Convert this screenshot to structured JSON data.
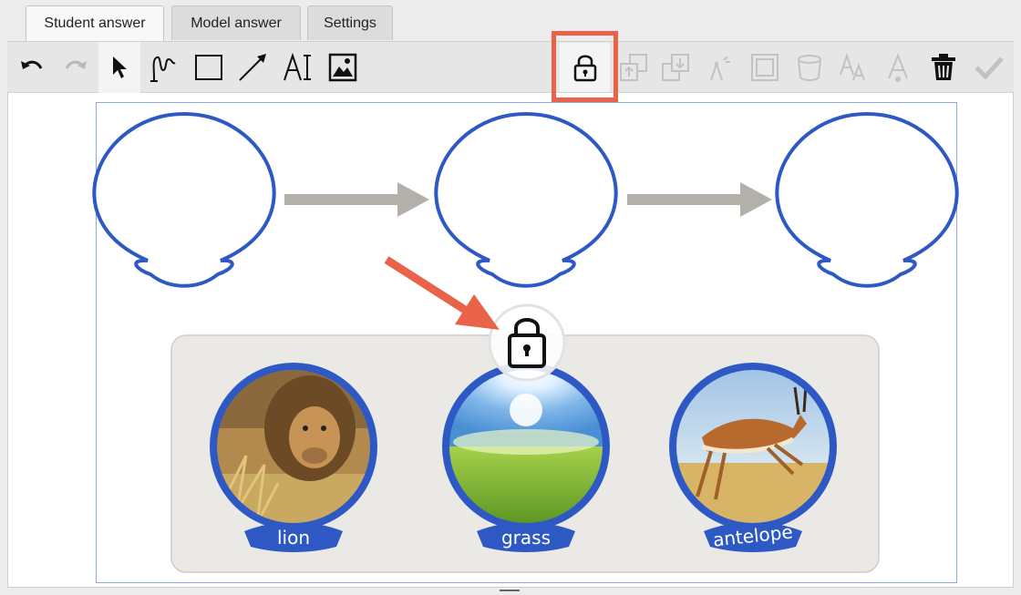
{
  "tabs": [
    {
      "label": "Student answer",
      "active": true
    },
    {
      "label": "Model answer",
      "active": false
    },
    {
      "label": "Settings",
      "active": false
    }
  ],
  "toolbar": {
    "tools": [
      "undo-icon",
      "redo-icon",
      "select-icon",
      "freehand-icon",
      "rectangle-icon",
      "arrow-line-icon",
      "text-icon",
      "image-icon",
      "lock-icon",
      "bring-forward-icon",
      "send-backward-icon",
      "edit-points-icon",
      "border-icon",
      "fill-icon",
      "font-size-icon",
      "text-color-icon",
      "trash-icon",
      "check-icon"
    ],
    "highlighted_tool": "lock-icon"
  },
  "canvas": {
    "flow_connector": "gray-arrow",
    "images": [
      {
        "label": "lion"
      },
      {
        "label": "grass"
      },
      {
        "label": "antelope"
      }
    ]
  },
  "colors": {
    "accent_blue": "#2e59c4",
    "highlight": "#e8634a",
    "arrow_gray": "#b3b0a9",
    "tray": "#ebe9e6"
  }
}
